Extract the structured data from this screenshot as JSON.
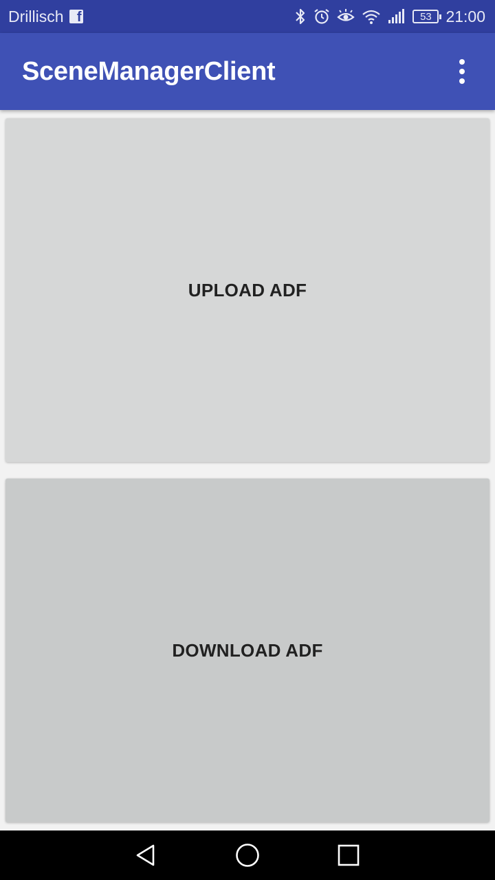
{
  "status_bar": {
    "carrier": "Drillisch",
    "battery_level": "53",
    "time": "21:00",
    "icons": [
      "facebook-icon",
      "bluetooth-icon",
      "alarm-icon",
      "eye-icon",
      "wifi-icon",
      "signal-icon",
      "battery-icon"
    ]
  },
  "app_bar": {
    "title": "SceneManagerClient",
    "overflow_icon": "more-vert-icon"
  },
  "main": {
    "upload_label": "UPLOAD ADF",
    "download_label": "DOWNLOAD ADF"
  },
  "nav_bar": {
    "icons": [
      "back-icon",
      "home-icon",
      "recents-icon"
    ]
  },
  "colors": {
    "status_bar": "#303f9f",
    "app_bar": "#3f51b5",
    "upload_button": "#d6d7d7",
    "download_button": "#c8caca",
    "nav_bar": "#000000"
  }
}
